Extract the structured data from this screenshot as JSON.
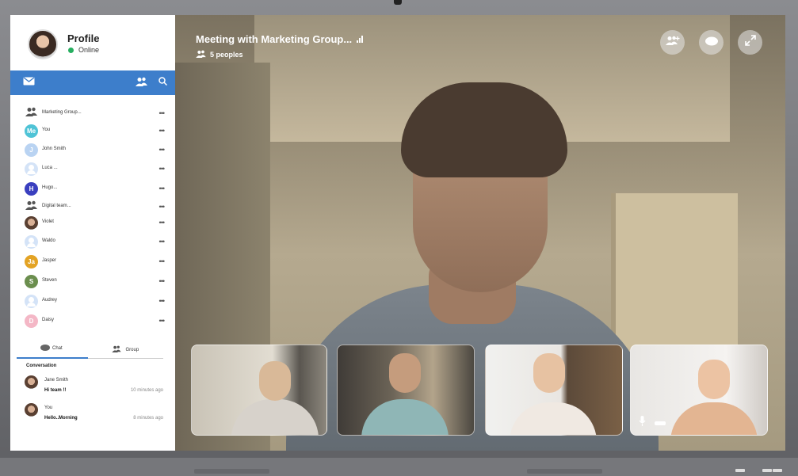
{
  "profile": {
    "title": "Profile",
    "status": "Online"
  },
  "toolbar": {
    "mail_icon": "mail-icon",
    "group_icon": "group-icon",
    "search_icon": "search-icon"
  },
  "contacts": [
    {
      "name": "Marketing Group...",
      "initials": "",
      "kind": "group",
      "color": ""
    },
    {
      "name": "You",
      "initials": "Me",
      "kind": "initials",
      "color": "#4fc3d6"
    },
    {
      "name": "John Smith",
      "initials": "J",
      "kind": "initials",
      "color": "#b9d3f2"
    },
    {
      "name": "Luca ...",
      "initials": "",
      "kind": "person",
      "color": ""
    },
    {
      "name": "Hugo...",
      "initials": "H",
      "kind": "initials",
      "color": "#3a3fbf"
    },
    {
      "name": "Digital team...",
      "initials": "",
      "kind": "group",
      "color": ""
    },
    {
      "name": "Violet",
      "initials": "",
      "kind": "photo",
      "color": ""
    },
    {
      "name": "Waldo",
      "initials": "",
      "kind": "person",
      "color": ""
    },
    {
      "name": "Jasper",
      "initials": "Ja",
      "kind": "initials",
      "color": "#e3a324"
    },
    {
      "name": "Steven",
      "initials": "S",
      "kind": "initials",
      "color": "#6b8e4e"
    },
    {
      "name": "Audrey",
      "initials": "",
      "kind": "person",
      "color": ""
    },
    {
      "name": "Daisy",
      "initials": "D",
      "kind": "initials",
      "color": "#f4b7c6"
    }
  ],
  "more_label": "•••",
  "tabs": {
    "chat": "Chat",
    "group": "Group"
  },
  "conversation": {
    "title": "Conversation",
    "messages": [
      {
        "name": "Jane Smith",
        "text": "Hi team !!",
        "time": "10 minutes ago"
      },
      {
        "name": "You",
        "text": "Hello..Morning",
        "time": "8 minutes ago"
      }
    ]
  },
  "meeting": {
    "title": "Meeting with Marketing Group...",
    "people": "5 peoples"
  },
  "controls": [
    "add-user-icon",
    "chat-icon",
    "fullscreen-icon"
  ],
  "colors": {
    "accent": "#3d7ecb",
    "online": "#27ae60"
  }
}
